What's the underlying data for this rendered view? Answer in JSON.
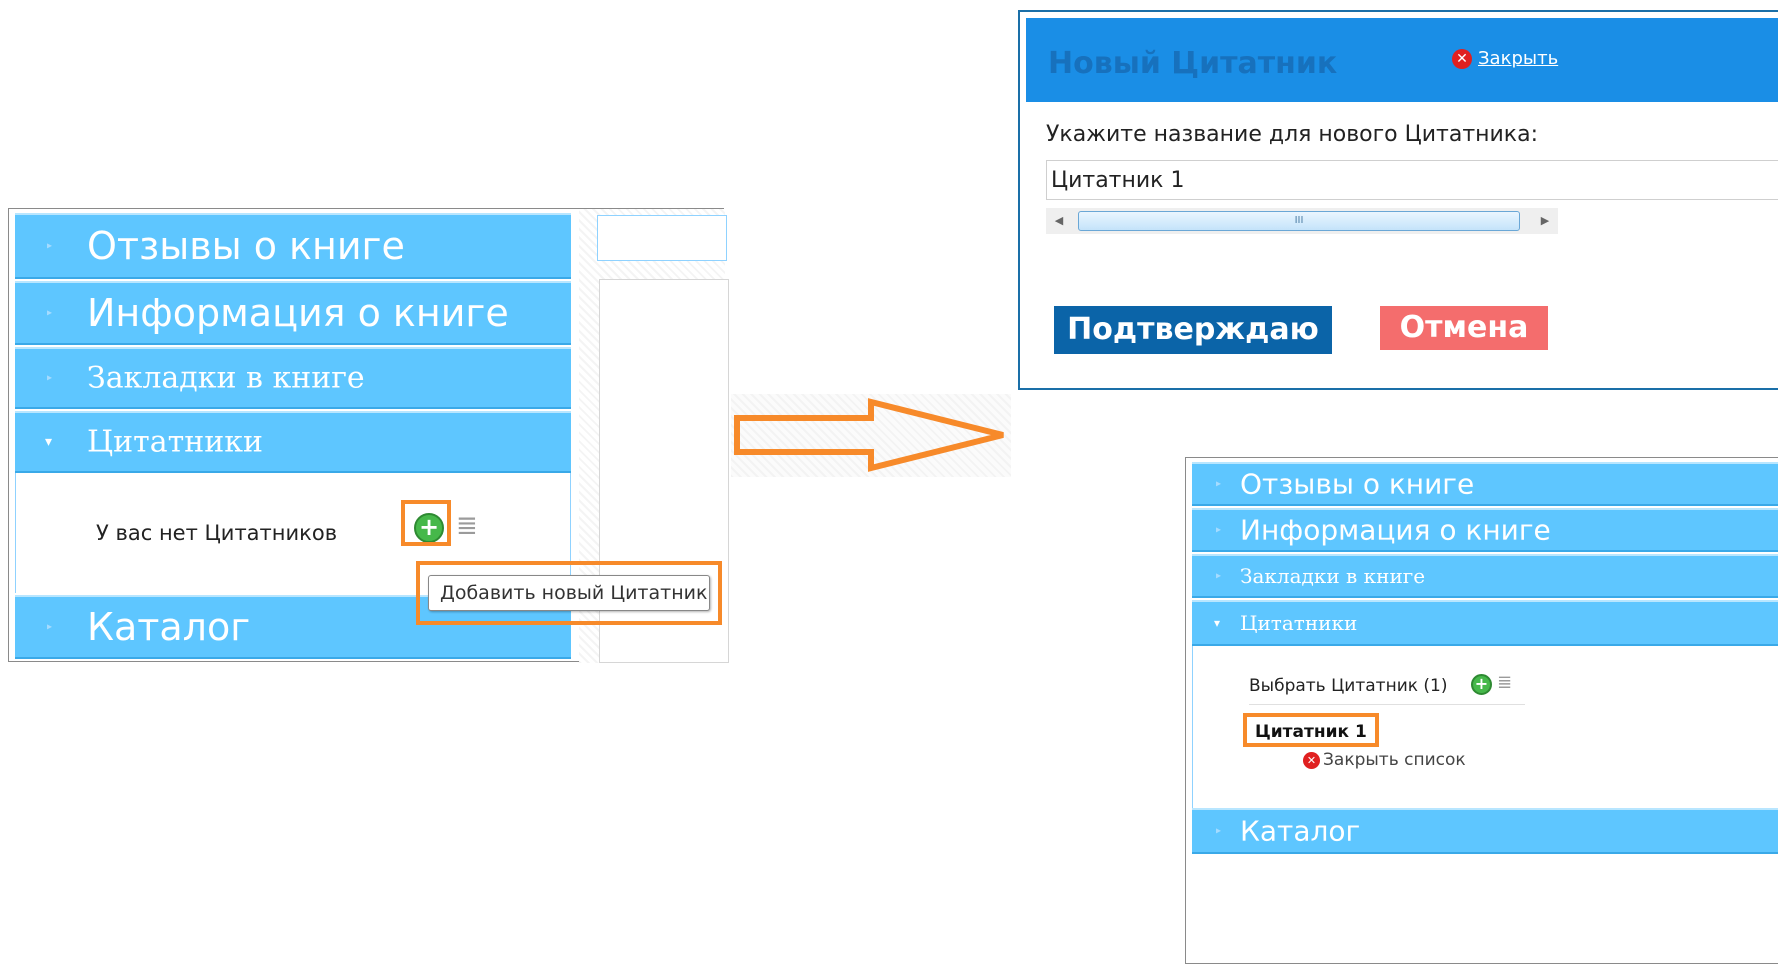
{
  "left_panel": {
    "accordion": [
      {
        "label": "Отзывы о книге"
      },
      {
        "label": "Информация о книге"
      },
      {
        "label": "Закладки в книге"
      },
      {
        "label": "Цитатники"
      },
      {
        "label": "Каталог"
      }
    ],
    "empty_text": "У вас нет Цитатников",
    "tooltip": "Добавить новый Цитатник"
  },
  "dialog": {
    "title": "Новый Цитатник",
    "close_label": "Закрыть",
    "prompt": "Укажите название для нового Цитатника:",
    "input_value": "Цитатник 1",
    "scroll_thumb": "III",
    "confirm_label": "Подтверждаю",
    "cancel_label": "Отмена"
  },
  "right_panel": {
    "accordion": [
      {
        "label": "Отзывы о книге"
      },
      {
        "label": "Информация о книге"
      },
      {
        "label": "Закладки в книге"
      },
      {
        "label": "Цитатники"
      },
      {
        "label": "Каталог"
      }
    ],
    "select_label": "Выбрать Цитатник (1)",
    "list_item": "Цитатник 1",
    "close_list_label": "Закрыть список"
  },
  "colors": {
    "accent_blue": "#5ec6ff",
    "dialog_header": "#1a8ee6",
    "confirm": "#0b64a8",
    "cancel": "#f46d6d",
    "highlight": "#f78a2a"
  },
  "icons": [
    "add-icon",
    "list-icon",
    "close-x-icon",
    "expand-arrow-icon",
    "collapse-arrow-icon"
  ]
}
